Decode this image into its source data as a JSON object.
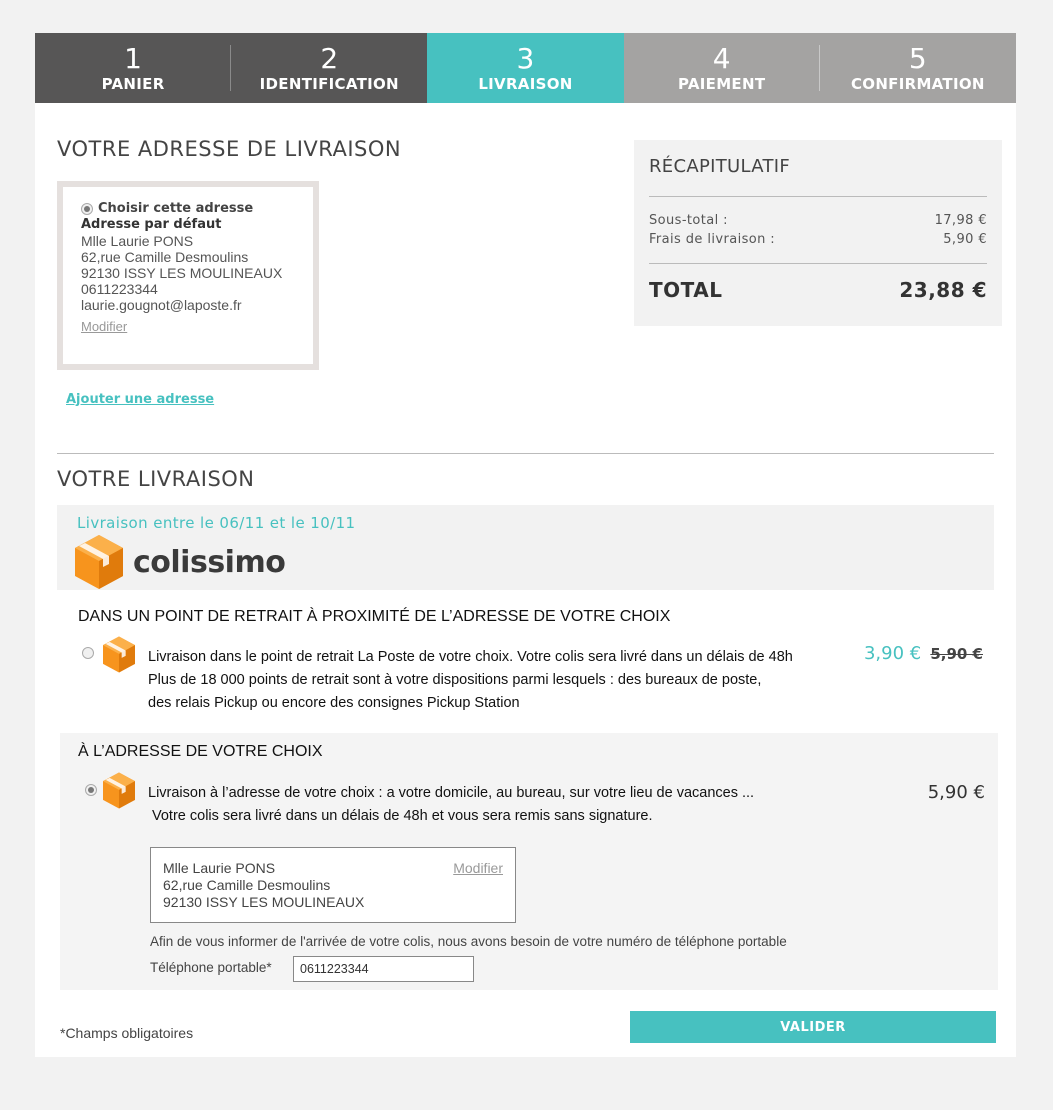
{
  "steps": [
    {
      "num": "1",
      "label": "PANIER",
      "state": "done"
    },
    {
      "num": "2",
      "label": "IDENTIFICATION",
      "state": "done"
    },
    {
      "num": "3",
      "label": "LIVRAISON",
      "state": "active"
    },
    {
      "num": "4",
      "label": "PAIEMENT",
      "state": "todo"
    },
    {
      "num": "5",
      "label": "CONFIRMATION",
      "state": "todo"
    }
  ],
  "address_section": {
    "title": "VOTRE ADRESSE DE LIVRAISON",
    "card": {
      "choose_label": "Choisir cette adresse",
      "default_label": "Adresse par défaut",
      "name": "Mlle Laurie PONS",
      "street": "62,rue Camille Desmoulins",
      "city": "92130 ISSY LES MOULINEAUX",
      "phone": "0611223344",
      "email": "laurie.gougnot@laposte.fr",
      "modify_label": "Modifier"
    },
    "add_address_label": "Ajouter une adresse"
  },
  "recap": {
    "title": "RÉCAPITULATIF",
    "subtotal_label": "Sous-total :",
    "subtotal_value": "17,98 €",
    "shipping_label": "Frais de livraison :",
    "shipping_value": "5,90 €",
    "total_label": "TOTAL",
    "total_value": "23,88 €"
  },
  "delivery_section": {
    "title": "VOTRE LIVRAISON",
    "date_range": "Livraison entre le 06/11 et le 10/11",
    "carrier_name": "colissimo",
    "option1": {
      "title": "DANS UN POINT DE RETRAIT À PROXIMITÉ DE L’ADRESSE DE VOTRE CHOIX",
      "line1": "Livraison dans le point de retrait La Poste de votre choix. Votre colis sera livré dans un délais de 48h",
      "line2": "Plus de 18 000 points de retrait sont à votre dispositions parmi lesquels : des bureaux de poste,",
      "line3": "des relais Pickup ou encore des consignes Pickup Station",
      "price": "3,90 €",
      "old_price": "5,90 €"
    },
    "option2": {
      "title": "À L’ADRESSE DE VOTRE CHOIX",
      "line1": "Livraison à l’adresse de votre choix : a votre domicile, au bureau, sur votre lieu de vacances ...",
      "line2": "Votre colis sera livré dans un délais de 48h et vous sera remis sans signature.",
      "price": "5,90 €",
      "address": {
        "name": "Mlle Laurie PONS",
        "street": "62,rue Camille Desmoulins",
        "city": "92130 ISSY LES MOULINEAUX",
        "modify_label": "Modifier"
      },
      "info_text": "Afin de vous informer de l'arrivée de votre colis, nous avons besoin de votre numéro de téléphone portable",
      "phone_label": "Téléphone portable*",
      "phone_value": "0611223344"
    }
  },
  "footer": {
    "required_note": "*Champs obligatoires",
    "validate_label": "VALIDER"
  },
  "colors": {
    "accent": "#47c1c0",
    "step_done": "#575656",
    "step_todo": "#a4a3a2",
    "colissimo_orange": "#f7941d"
  },
  "icons": [
    "colissimo-box-icon",
    "radio-icon"
  ]
}
